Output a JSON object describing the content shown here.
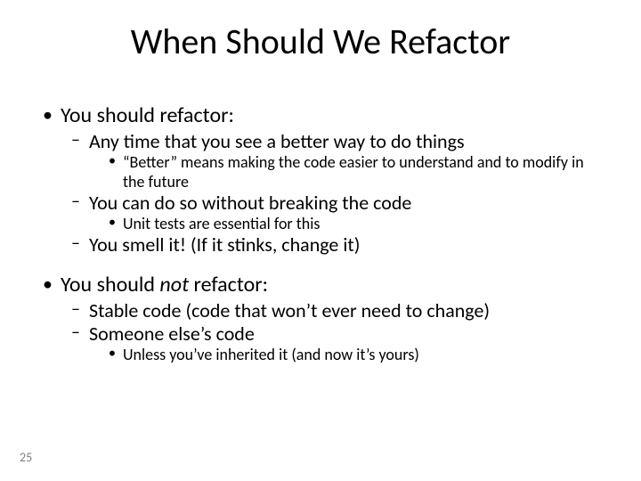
{
  "title": "When Should We Refactor",
  "sec1": {
    "heading": "You should refactor:",
    "p1": "Any time that you see a better way to do things",
    "p1a": "“Better” means making the code easier to understand and to modify in the future",
    "p2": "You can do so without breaking the code",
    "p2a": "Unit tests are essential for this",
    "p3": "You smell it! (If it stinks, change it)"
  },
  "sec2": {
    "heading_pre": "You should ",
    "heading_em": "not",
    "heading_post": " refactor:",
    "p1": "Stable code (code that won’t ever need to change)",
    "p2": "Someone else’s code",
    "p2a": "Unless you’ve inherited it (and now it’s yours)"
  },
  "page": "25"
}
